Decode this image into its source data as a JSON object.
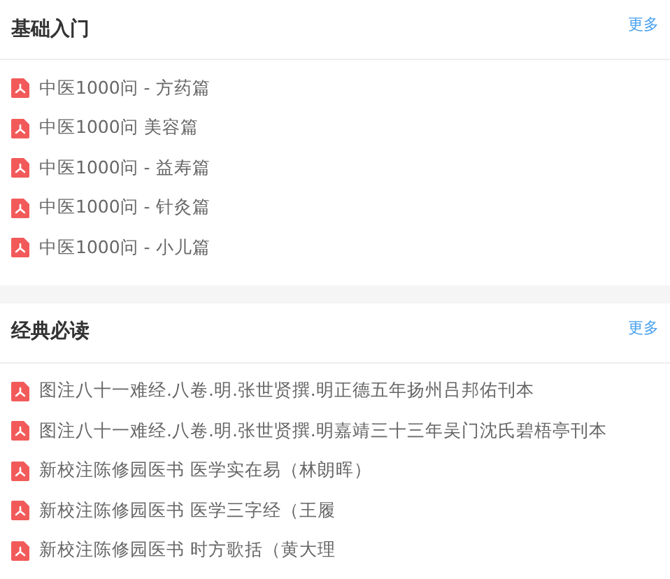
{
  "sections": [
    {
      "title": "基础入门",
      "more": "更多",
      "items": [
        {
          "label": "中医1000问 - 方药篇"
        },
        {
          "label": "中医1000问 美容篇"
        },
        {
          "label": "中医1000问 - 益寿篇"
        },
        {
          "label": "中医1000问 - 针灸篇"
        },
        {
          "label": "中医1000问 - 小儿篇"
        }
      ]
    },
    {
      "title": "经典必读",
      "more": "更多",
      "items": [
        {
          "label": "图注八十一难经.八卷.明.张世贤撰.明正德五年扬州吕邦佑刊本"
        },
        {
          "label": "图注八十一难经.八卷.明.张世贤撰.明嘉靖三十三年吴门沈氏碧梧亭刊本"
        },
        {
          "label": "新校注陈修园医书 医学实在易（林朗晖）"
        },
        {
          "label": "新校注陈修园医书 医学三字经（王履"
        },
        {
          "label": "新校注陈修园医书 时方歌括（黄大理"
        }
      ]
    }
  ]
}
